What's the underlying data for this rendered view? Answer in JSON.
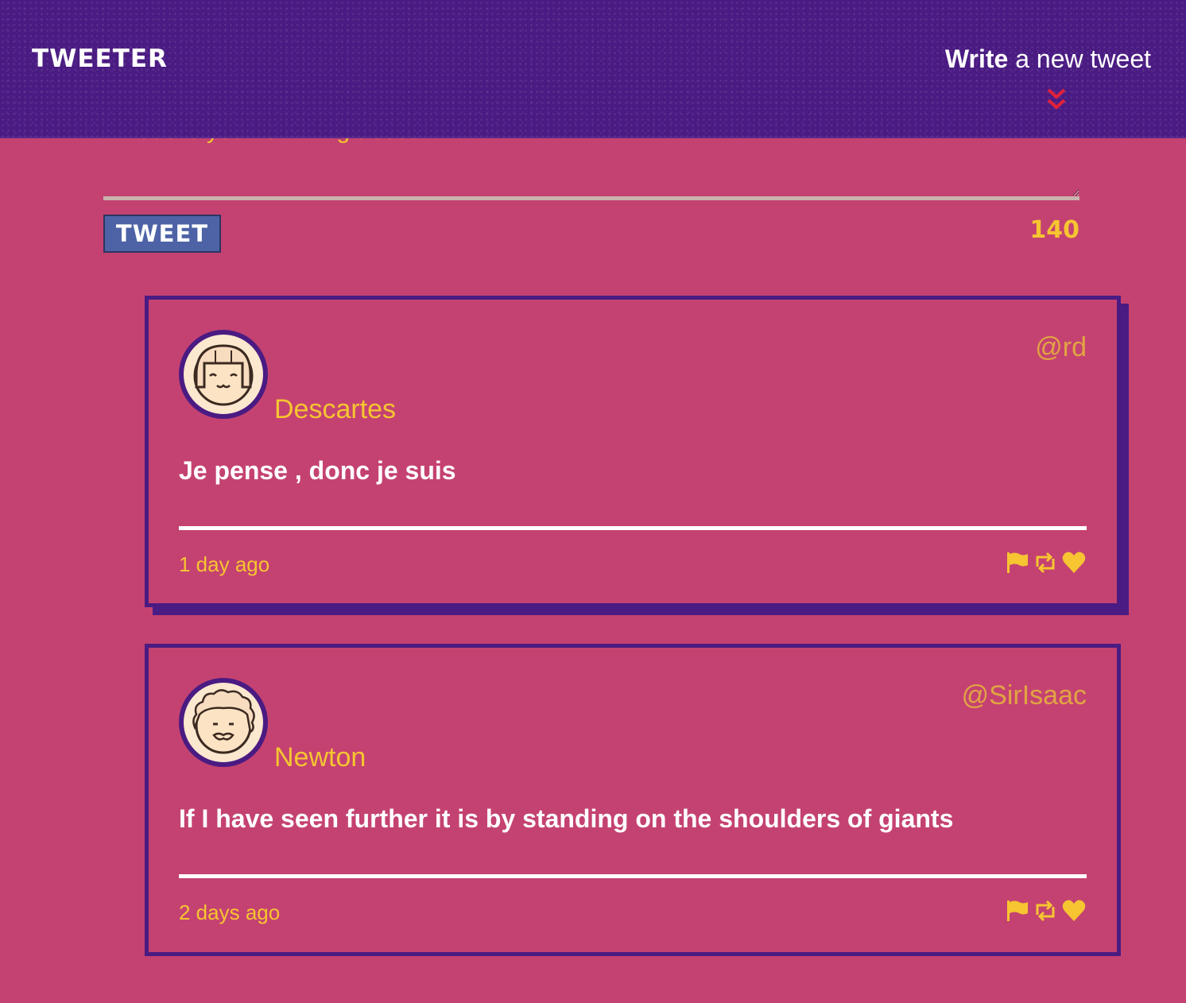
{
  "nav": {
    "logo": "TWEETER",
    "compose_bold": "Write",
    "compose_rest": " a new tweet"
  },
  "compose": {
    "placeholder": "What are you humming about?",
    "button_label": "TWEET",
    "counter": "140"
  },
  "tweets": [
    {
      "name": "Descartes",
      "handle": "@rd",
      "text": "Je pense , donc je suis",
      "time": "1 day ago"
    },
    {
      "name": "Newton",
      "handle": "@SirIsaac",
      "text": "If I have seen further it is by standing on the shoulders of giants",
      "time": "2 days ago"
    }
  ],
  "icons": {
    "toggle": "double-chevron-down-icon",
    "flag": "flag-icon",
    "retweet": "retweet-icon",
    "like": "heart-icon"
  },
  "colors": {
    "background": "#c44271",
    "navbar": "#4a1b82",
    "accent": "#f6c531",
    "handle": "#e1a443",
    "button": "#4d63a6",
    "chevron": "#e0213a"
  }
}
